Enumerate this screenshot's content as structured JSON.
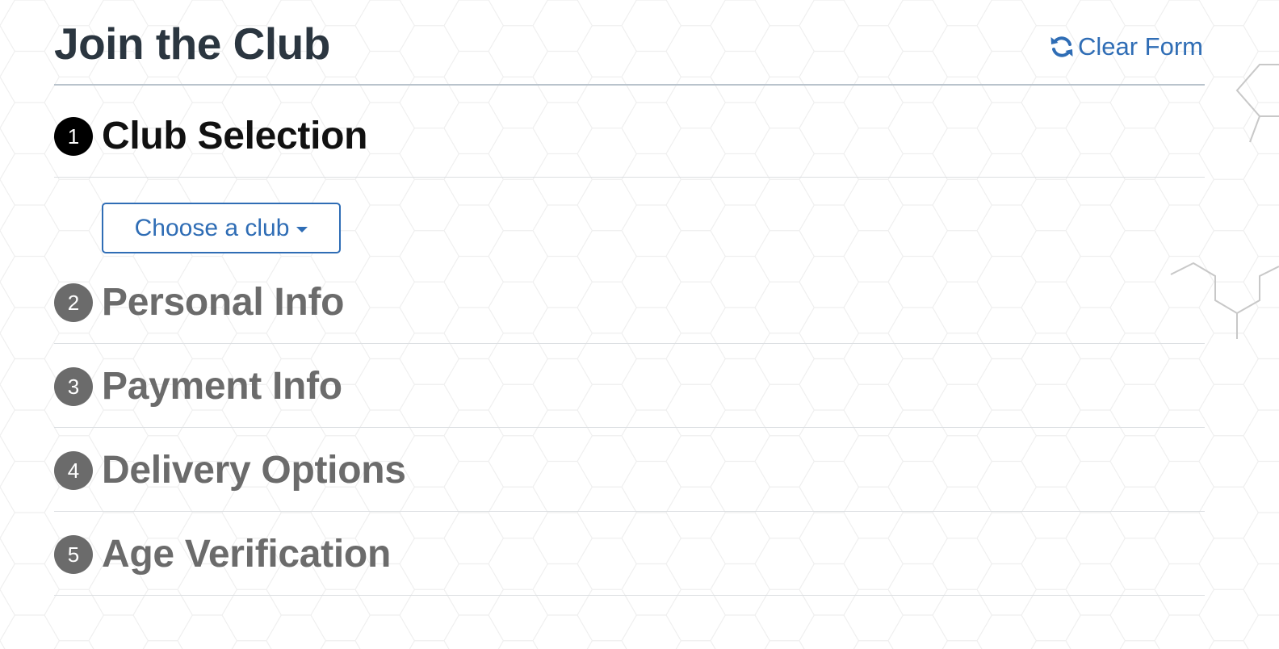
{
  "header": {
    "title": "Join the Club",
    "clear_form_label": "Clear Form",
    "clear_form_icon": "refresh-icon"
  },
  "steps": [
    {
      "number": "1",
      "title": "Club Selection",
      "active": true
    },
    {
      "number": "2",
      "title": "Personal Info",
      "active": false
    },
    {
      "number": "3",
      "title": "Payment Info",
      "active": false
    },
    {
      "number": "4",
      "title": "Delivery Options",
      "active": false
    },
    {
      "number": "5",
      "title": "Age Verification",
      "active": false
    }
  ],
  "club_selection": {
    "dropdown_label": "Choose a club",
    "dropdown_icon": "caret-down-icon"
  },
  "colors": {
    "title": "#2b3640",
    "link": "#2f6db5",
    "active_step": "#111111",
    "inactive_step": "#6b6b6b",
    "divider": "#dcdfe2"
  }
}
